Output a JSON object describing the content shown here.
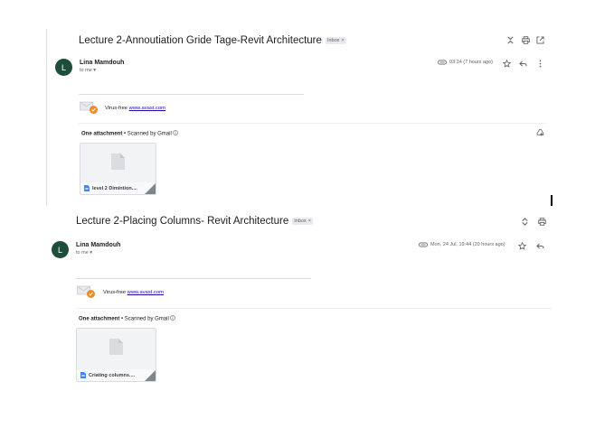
{
  "email1": {
    "subject": "Lecture 2-Annoutiation Gride Tage-Revit Architecture",
    "badge": "Inbox",
    "badge_close": "×",
    "avatar_letter": "L",
    "sender": "Lina Mamdouh",
    "to": "to me",
    "time": "03:24 (7 hours ago)",
    "virus_text": "Virus-free",
    "virus_link": "www.avast.com",
    "attachment_count": "One attachment",
    "scanned": " • Scanned by Gmail",
    "file_name": "level 2 Dimintion...."
  },
  "email2": {
    "subject": "Lecture 2-Placing Columns- Revit Architecture",
    "badge": "Inbox",
    "badge_close": "×",
    "avatar_letter": "L",
    "sender": "Lina Mamdouh",
    "to": "to me",
    "time": "Mon, 24 Jul, 19:44 (20 hours ago)",
    "virus_text": "Virus-free",
    "virus_link": "www.avast.com",
    "attachment_count": "One attachment",
    "scanned": " • Scanned by Gmail",
    "file_name": "Criating columns...."
  },
  "colors": {
    "avatar": "#1e4d3a",
    "link": "#1a0dab",
    "avast_orange": "#f08a24",
    "doc_blue": "#4285f4"
  }
}
